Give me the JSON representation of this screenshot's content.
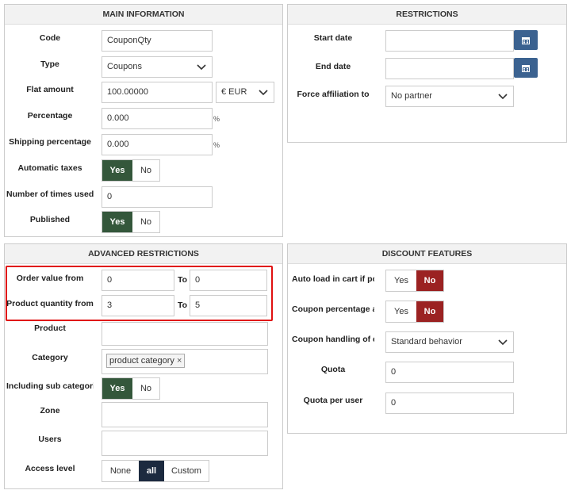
{
  "main_info": {
    "title": "MAIN INFORMATION",
    "code_label": "Code",
    "code_value": "CouponQty",
    "type_label": "Type",
    "type_value": "Coupons",
    "flat_label": "Flat amount",
    "flat_value": "100.00000",
    "currency": "€ EUR",
    "percentage_label": "Percentage",
    "percentage_value": "0.000",
    "percent_unit": "%",
    "shipping_label": "Shipping percentage",
    "shipping_value": "0.000",
    "auto_taxes_label": "Automatic taxes",
    "times_used_label": "Number of times used",
    "times_used_value": "0",
    "published_label": "Published",
    "yes": "Yes",
    "no": "No"
  },
  "restrictions": {
    "title": "RESTRICTIONS",
    "start_label": "Start date",
    "end_label": "End date",
    "force_label": "Force affiliation to",
    "force_value": "No partner"
  },
  "advanced": {
    "title": "ADVANCED RESTRICTIONS",
    "order_label": "Order value from",
    "order_from": "0",
    "order_to": "0",
    "qty_label": "Product quantity from",
    "qty_from": "3",
    "qty_to": "5",
    "to": "To",
    "product_label": "Product",
    "category_label": "Category",
    "category_tag": "product category",
    "tag_remove": "×",
    "subcat_label": "Including sub categorie",
    "zone_label": "Zone",
    "users_label": "Users",
    "access_label": "Access level",
    "access_none": "None",
    "access_all": "all",
    "access_custom": "Custom"
  },
  "discount": {
    "title": "DISCOUNT FEATURES",
    "autoload_label": "Auto load in cart if pos",
    "coupon_pct_label": "Coupon percentage ap",
    "handling_label": "Coupon handling of dis",
    "handling_value": "Standard behavior",
    "quota_label": "Quota",
    "quota_value": "0",
    "quota_user_label": "Quota per user",
    "quota_user_value": "0"
  }
}
